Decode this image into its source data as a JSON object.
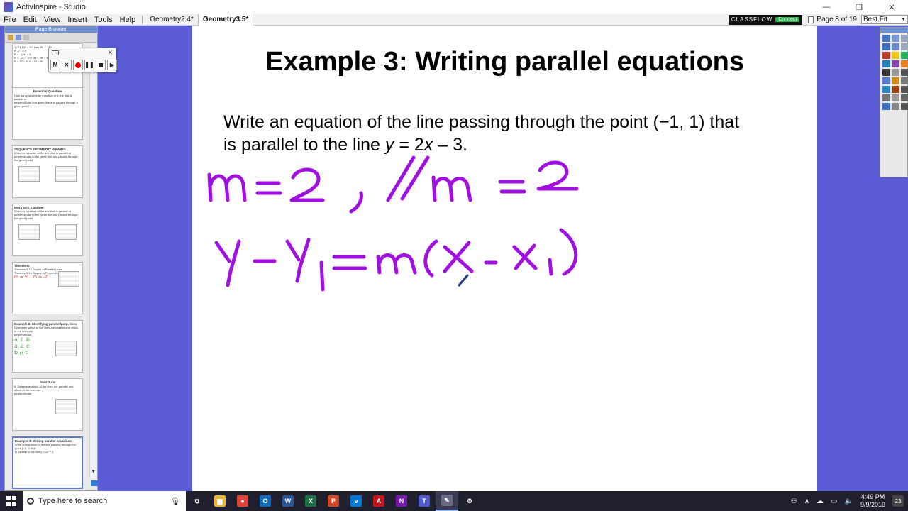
{
  "window": {
    "title": "ActivInspire - Studio",
    "controls": [
      "—",
      "❐",
      "✕"
    ]
  },
  "menu": {
    "items": [
      "File",
      "Edit",
      "View",
      "Insert",
      "Tools",
      "Help"
    ],
    "documents": [
      {
        "label": "Geometry2.4*",
        "active": false
      },
      {
        "label": "Geometry3.5*",
        "active": true
      }
    ],
    "classflow_label": "CLASSFLOW",
    "classflow_status": "Connect",
    "page_indicator": "Page 8 of 19",
    "zoom_value": "Best Fit"
  },
  "page_browser": {
    "title": "Page Browser",
    "thumbnails": [
      {
        "title": "",
        "lines": [
          "1) PT RO = AC  Has (R- + - R)",
          "R -> r = x",
          "R = - (2k) = 6",
          "R = -(2) + 10 * dd = 3R = 90",
          "R = 52 = 8, 6 = 52 = 8x"
        ]
      },
      {
        "title": "Essential Question",
        "lines": [
          "How can you write an equation of a line that is parallel or",
          "perpendicular to a given line and passes through a given point?"
        ]
      },
      {
        "title": "SEQUENCE GEOMETRY VIEWING",
        "lines": [
          "Write an equation of the line that is parallel or",
          "perpendicular to the given line and passes through the given point."
        ]
      },
      {
        "title": "Work with a partner.",
        "lines": [
          "Write an equation of the line that is parallel or",
          "perpendicular to the given line and passes through the given point."
        ]
      },
      {
        "title": "Theorems",
        "lines": [
          "Theorem 3.13  Slopes of Parallel Lines",
          "Theorem 3.14  Slopes of Perpendicular Lines"
        ],
        "handwriting": "m = ½   m = -2"
      },
      {
        "title": "Example 2: Identifying parallel/perp. lines",
        "lines": [
          "Determine which of the lines are parallel and which of the lines are",
          "perpendicular."
        ],
        "handwriting": "a ⊥ b\na ⊥ c\nb // c"
      },
      {
        "title": "Your Turn",
        "lines": [
          "8. Determine which of the lines are parallel and which of the lines are",
          "perpendicular."
        ]
      },
      {
        "title": "Example 3: Writing parallel equations",
        "lines": [
          "Write an equation of the line passing through the point (−1, 1) that",
          "is parallel to the line y = 2x − 3."
        ]
      }
    ]
  },
  "recorder": {
    "buttons": [
      "M",
      "✕",
      "rec",
      "❚❚",
      "stop",
      "▶"
    ]
  },
  "slide": {
    "title": "Example 3: Writing parallel equations",
    "prompt_line1": "Write an equation of the line passing through the point (−1, 1) that",
    "prompt_line2_prefix": "is parallel to the line ",
    "prompt_var_y": "y",
    "prompt_eq": " = 2",
    "prompt_var_x": "x",
    "prompt_end": " – 3.",
    "ink_color": "#a010e0"
  },
  "taskbar": {
    "search_placeholder": "Type here to search",
    "apps": [
      {
        "name": "task-view",
        "glyph": "⧉",
        "color": "#1f1f2e"
      },
      {
        "name": "file-explorer",
        "glyph": "▆",
        "color": "#e8b53a"
      },
      {
        "name": "chrome",
        "glyph": "●",
        "color": "#db4437"
      },
      {
        "name": "outlook",
        "glyph": "O",
        "color": "#0f6cbd"
      },
      {
        "name": "word",
        "glyph": "W",
        "color": "#2b5797"
      },
      {
        "name": "excel",
        "glyph": "X",
        "color": "#1e7145"
      },
      {
        "name": "powerpoint",
        "glyph": "P",
        "color": "#d24726"
      },
      {
        "name": "edge",
        "glyph": "e",
        "color": "#0078d7"
      },
      {
        "name": "acrobat",
        "glyph": "A",
        "color": "#c4171d"
      },
      {
        "name": "onenote",
        "glyph": "N",
        "color": "#7719aa"
      },
      {
        "name": "teams",
        "glyph": "T",
        "color": "#5059c9"
      },
      {
        "name": "activinspire",
        "glyph": "✎",
        "color": "#6a6a80"
      },
      {
        "name": "settings",
        "glyph": "⚙",
        "color": "#1f1f2e"
      }
    ],
    "time": "4:49 PM",
    "date": "9/9/2019",
    "notification_count": "23"
  }
}
